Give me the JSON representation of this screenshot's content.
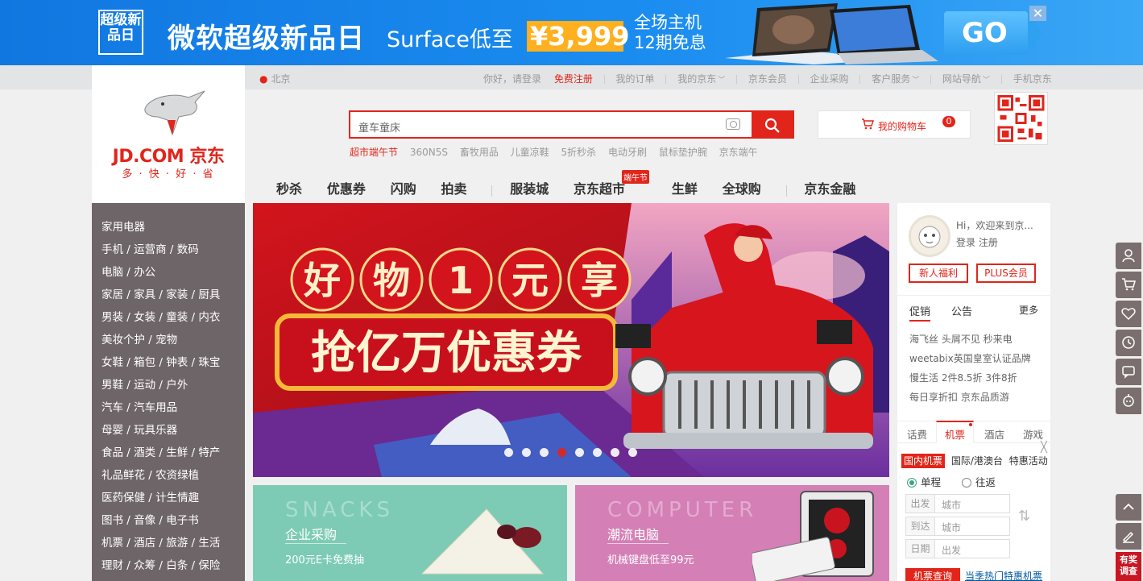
{
  "promo": {
    "logo_text": "超级新品日",
    "headline": "微软超级新品日",
    "surface": "Surface低至",
    "price": "¥3,999",
    "fullsite_line1": "全场主机",
    "fullsite_line2": "12期免息",
    "go": "GO",
    "close": "✕"
  },
  "shortcut": {
    "location": "北京",
    "greeting": "你好，请登录",
    "register": "免费注册",
    "links": [
      "我的订单",
      "我的京东",
      "京东会员",
      "企业采购",
      "客户服务",
      "网站导航",
      "手机京东"
    ]
  },
  "logo": {
    "brand": "JD.COM 京东",
    "slogan": "多 · 快 · 好 · 省"
  },
  "search": {
    "placeholder": "童车童床",
    "hotwords": [
      "超市端午节",
      "360N5S",
      "畜牧用品",
      "儿童凉鞋",
      "5折秒杀",
      "电动牙刷",
      "鼠标垫护腕",
      "京东端午"
    ]
  },
  "cart": {
    "label": "我的购物车",
    "count": "0"
  },
  "nav": {
    "items": [
      "秒杀",
      "优惠券",
      "闪购",
      "拍卖",
      "服装城",
      "京东超市",
      "生鲜",
      "全球购",
      "京东金融"
    ],
    "tag": "端午节"
  },
  "categories": [
    "家用电器",
    "手机 / 运营商 / 数码",
    "电脑 / 办公",
    "家居 / 家具 / 家装 / 厨具",
    "男装 / 女装 / 童装 / 内衣",
    "美妆个护 / 宠物",
    "女鞋 / 箱包 / 钟表 / 珠宝",
    "男鞋 / 运动 / 户外",
    "汽车 / 汽车用品",
    "母婴 / 玩具乐器",
    "食品 / 酒类 / 生鲜 / 特产",
    "礼品鲜花 / 农资绿植",
    "医药保健 / 计生情趣",
    "图书 / 音像 / 电子书",
    "机票 / 酒店 / 旅游 / 生活",
    "理财 / 众筹 / 白条 / 保险"
  ],
  "banner": {
    "chars": [
      "好",
      "物",
      "1",
      "元",
      "享"
    ],
    "slogan": "抢亿万优惠券",
    "slide_active": 4,
    "slide_count": 8
  },
  "sub_banners": [
    {
      "bg_text": "SNACKS",
      "title": "企业采购",
      "subtitle": "200元E卡免费抽"
    },
    {
      "bg_text": "COMPUTER",
      "title": "潮流电脑",
      "subtitle": "机械键盘低至99元"
    }
  ],
  "user": {
    "greeting": "Hi，欢迎来到京...",
    "login": "登录 注册",
    "btn_newcomer": "新人福利",
    "btn_plus": "PLUS会员"
  },
  "news": {
    "tab_promo": "促销",
    "tab_notice": "公告",
    "more": "更多",
    "items": [
      "海飞丝 头屑不见 秒来电",
      "weetabix英国皇室认证品牌",
      "慢生活 2件8.5折 3件8折",
      "每日享折扣 京东品质游"
    ]
  },
  "services": {
    "tabs": [
      "话费",
      "机票",
      "酒店",
      "游戏"
    ],
    "flight_types": [
      "国内机票",
      "国际/港澳台",
      "特惠活动"
    ],
    "trip_oneway": "单程",
    "trip_round": "往返",
    "from_label": "出发",
    "from_value": "城市",
    "to_label": "到达",
    "to_value": "城市",
    "date_label": "日期",
    "date_value": "出发",
    "query": "机票查询",
    "hot": "当季热门特惠机票",
    "close": "╳"
  },
  "survey": "有奖调查",
  "colors": {
    "accent": "#e1251b",
    "sidebar": "#6e6568",
    "promo_blue": "#1a8cf0"
  }
}
